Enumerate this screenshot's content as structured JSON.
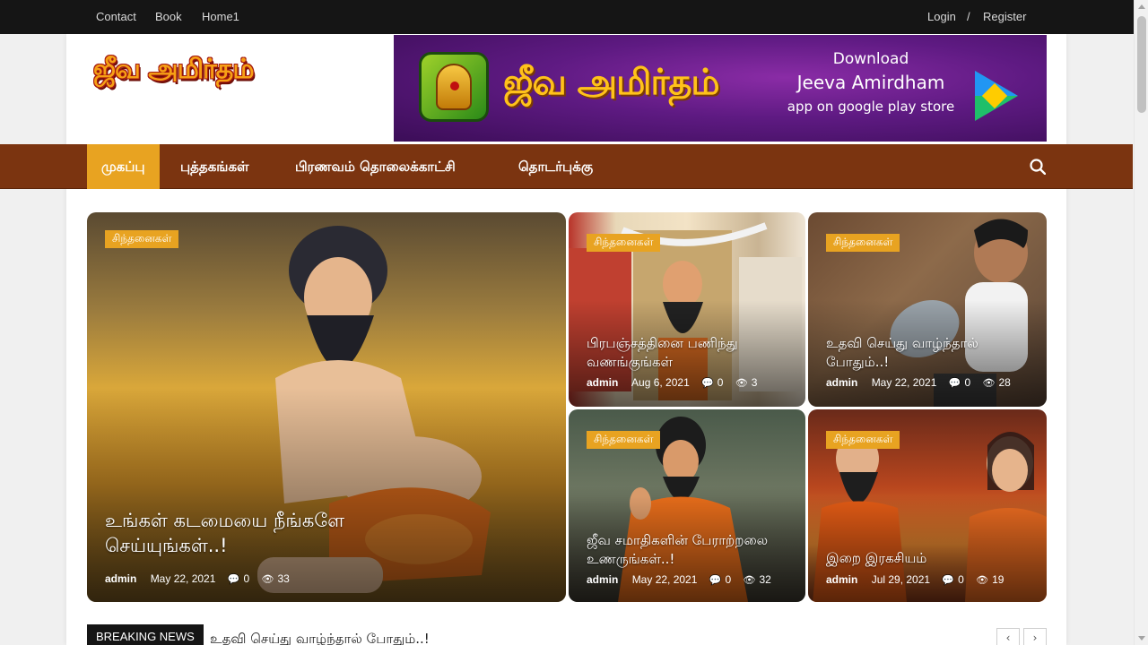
{
  "topbar": {
    "links": [
      "Contact",
      "Book",
      "Home1"
    ],
    "login": "Login",
    "separator": "/",
    "register": "Register"
  },
  "logo": {
    "text": "ஜீவ அமிர்தம்"
  },
  "banner": {
    "title": "ஜீவ அமிர்தம்",
    "line1": "Download",
    "line2": "Jeeva Amirdham",
    "line3": "app on google play store"
  },
  "nav": {
    "items": [
      "முகப்பு",
      "புத்தகங்கள்",
      "பிரணவம் தொலைக்காட்சி",
      "தொடர்புக்கு"
    ],
    "active_index": 0,
    "search_icon": "search-icon"
  },
  "posts": [
    {
      "category": "சிந்தனைகள்",
      "title": "உங்கள் கடமையை நீங்களே செய்யுங்கள்..!",
      "author": "admin",
      "date": "May 22, 2021",
      "comments": "0",
      "views": "33"
    },
    {
      "category": "சிந்தனைகள்",
      "title": "பிரபஞ்சத்தினை பணிந்து வணங்குங்கள்",
      "author": "admin",
      "date": "Aug 6, 2021",
      "comments": "0",
      "views": "3"
    },
    {
      "category": "சிந்தனைகள்",
      "title": "உதவி செய்து வாழ்ந்தால் போதும்..!",
      "author": "admin",
      "date": "May 22, 2021",
      "comments": "0",
      "views": "28"
    },
    {
      "category": "சிந்தனைகள்",
      "title": "ஜீவ சமாதிகளின் பேராற்றலை உணருங்கள்..!",
      "author": "admin",
      "date": "May 22, 2021",
      "comments": "0",
      "views": "32"
    },
    {
      "category": "சிந்தனைகள்",
      "title": "இறை இரகசியம்",
      "author": "admin",
      "date": "Jul 29, 2021",
      "comments": "0",
      "views": "19"
    }
  ],
  "breaking": {
    "label": "BREAKING NEWS",
    "headline": "உதவி செய்து வாழ்ந்தால் போதும்..!",
    "prev": "‹",
    "next": "›"
  },
  "colors": {
    "nav_bg": "#7b3410",
    "accent": "#e8a321",
    "topbar_bg": "#151515"
  }
}
